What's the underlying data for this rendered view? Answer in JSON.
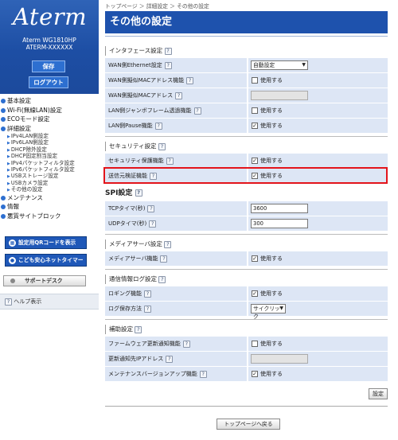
{
  "sidebar": {
    "logo": "Aterm",
    "model_line1": "Aterm WG1810HP",
    "model_line2": "ATERM-XXXXXX",
    "save_label": "保存",
    "logout_label": "ログアウト",
    "menu": [
      {
        "label": "基本設定"
      },
      {
        "label": "Wi-Fi(無線LAN)設定"
      },
      {
        "label": "ECOモード設定"
      },
      {
        "label": "詳細設定"
      }
    ],
    "submenu": [
      "IPv4LAN側設定",
      "IPv6LAN側設定",
      "DHCP除外設定",
      "DHCP固定割当設定",
      "IPv4パケットフィルタ設定",
      "IPv6パケットフィルタ設定",
      "USBストレージ設定",
      "USBカメラ設定",
      "その他の設定"
    ],
    "menu2": [
      {
        "label": "メンテナンス"
      },
      {
        "label": "情報"
      },
      {
        "label": "悪質サイトブロック"
      }
    ],
    "qr_button": "設定用QRコードを表示",
    "child_button": "こども安心ネットタイマー",
    "support_button": "サポートデスク",
    "help_label": "ヘルプ表示"
  },
  "breadcrumb": "トップページ ＞ 詳細設定 ＞ その他の設定",
  "page_title": "その他の設定",
  "sections": {
    "interface": {
      "title": "インタフェース設定",
      "rows": [
        {
          "label": "WAN側Ethernet設定",
          "type": "select",
          "value": "自動設定"
        },
        {
          "label": "WAN側擬似MACアドレス機能",
          "type": "checkbox",
          "value": "使用する",
          "checked": false
        },
        {
          "label": "WAN側擬似MACアドレス",
          "type": "text-disabled",
          "value": ""
        },
        {
          "label": "LAN側ジャンボフレーム透過機能",
          "type": "checkbox",
          "value": "使用する",
          "checked": false
        },
        {
          "label": "LAN側Pause機能",
          "type": "checkbox",
          "value": "使用する",
          "checked": true
        }
      ]
    },
    "security": {
      "title": "セキュリティ設定",
      "rows": [
        {
          "label": "セキュリティ保護機能",
          "type": "checkbox",
          "value": "使用する",
          "checked": true
        },
        {
          "label": "送信元検証機能",
          "type": "checkbox",
          "value": "使用する",
          "checked": true
        }
      ]
    },
    "spi": {
      "title": "SPI設定",
      "rows": [
        {
          "label": "TCPタイマ(秒)",
          "type": "text",
          "value": "3600"
        },
        {
          "label": "UDPタイマ(秒)",
          "type": "text",
          "value": "300"
        }
      ]
    },
    "media": {
      "title": "メディアサーバ設定",
      "rows": [
        {
          "label": "メディアサーバ機能",
          "type": "checkbox",
          "value": "使用する",
          "checked": true
        }
      ]
    },
    "log": {
      "title": "通信情報ログ設定",
      "rows": [
        {
          "label": "ロギング機能",
          "type": "checkbox",
          "value": "使用する",
          "checked": true
        },
        {
          "label": "ログ保存方法",
          "type": "select-small",
          "value": "サイクリック"
        }
      ]
    },
    "aux": {
      "title": "補助設定",
      "rows": [
        {
          "label": "ファームウェア更新通知機能",
          "type": "checkbox",
          "value": "使用する",
          "checked": false
        },
        {
          "label": "更新通知先IPアドレス",
          "type": "text-disabled",
          "value": ""
        },
        {
          "label": "メンテナンスバージョンアップ機能",
          "type": "checkbox",
          "value": "使用する",
          "checked": true
        }
      ]
    }
  },
  "apply_button": "設定",
  "top_button": "トップページへ戻る",
  "colors": {
    "header_blue": "#1e52ad",
    "row_bg": "#dde6f5",
    "highlight_red": "#e3141b"
  }
}
